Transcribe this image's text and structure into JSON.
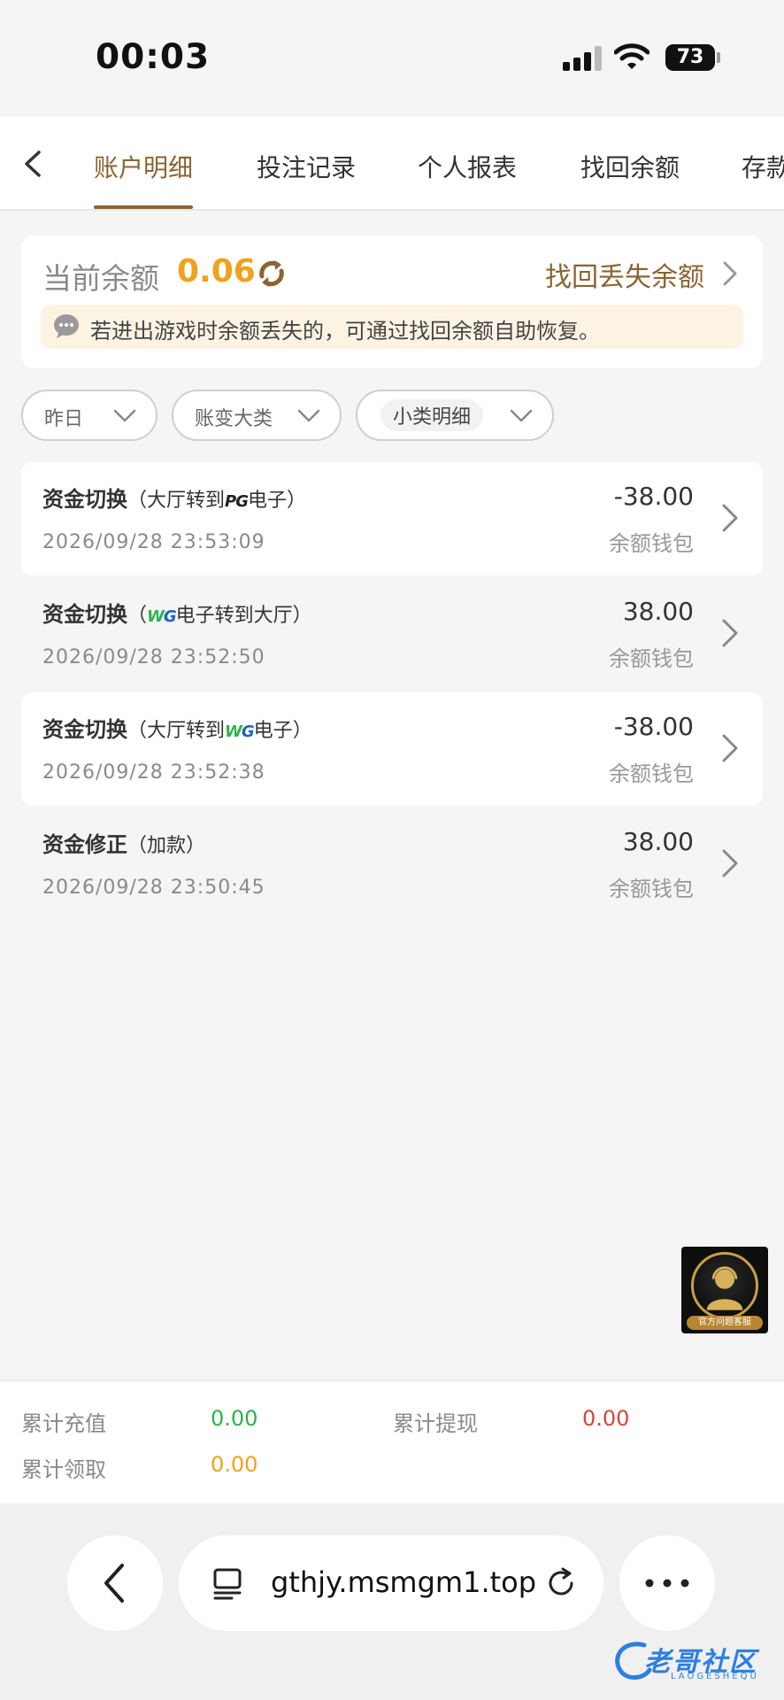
{
  "status_bar": {
    "time": "00:03",
    "battery": "73"
  },
  "tabs": [
    {
      "label": "账户明细",
      "active": true
    },
    {
      "label": "投注记录",
      "active": false
    },
    {
      "label": "个人报表",
      "active": false
    },
    {
      "label": "找回余额",
      "active": false
    },
    {
      "label": "存款",
      "active": false
    }
  ],
  "balance": {
    "label": "当前余额",
    "value": "0.06",
    "recover_link": "找回丢失余额",
    "notice": "若进出游戏时余额丢失的，可通过找回余额自助恢复。"
  },
  "filters": [
    {
      "label": "昨日"
    },
    {
      "label": "账变大类"
    },
    {
      "label": "小类明细"
    }
  ],
  "records": [
    {
      "title": "资金切换",
      "paren_open": "（",
      "sub_pre": "大厅转到",
      "logo": "PG",
      "sub_post": "电子",
      "paren_close": "）",
      "date": "2026/09/28 23:53:09",
      "amount": "-38.00",
      "wallet": "余额钱包"
    },
    {
      "title": "资金切换",
      "paren_open": "（",
      "sub_pre": "",
      "logo": "WG",
      "sub_post": "电子转到大厅",
      "paren_close": "）",
      "date": "2026/09/28 23:52:50",
      "amount": "38.00",
      "wallet": "余额钱包"
    },
    {
      "title": "资金切换",
      "paren_open": "（",
      "sub_pre": "大厅转到",
      "logo": "WG",
      "sub_post": "电子",
      "paren_close": "）",
      "date": "2026/09/28 23:52:38",
      "amount": "-38.00",
      "wallet": "余额钱包"
    },
    {
      "title": "资金修正",
      "paren_open": "（",
      "sub_pre": "加款",
      "logo": "",
      "sub_post": "",
      "paren_close": "）",
      "date": "2026/09/28 23:50:45",
      "amount": "38.00",
      "wallet": "余额钱包"
    }
  ],
  "support": {
    "label": "官方问题客服"
  },
  "totals": {
    "recharge_label": "累计充值",
    "recharge_value": "0.00",
    "withdraw_label": "累计提现",
    "withdraw_value": "0.00",
    "claim_label": "累计领取",
    "claim_value": "0.00"
  },
  "browser": {
    "url": "gthjy.msmgm1.top"
  },
  "watermark": {
    "text": "老哥社区",
    "sub": "LAOGESHEQU"
  },
  "colors": {
    "accent": "#8b6432",
    "balance": "#f0a21c",
    "green": "#2cb34a",
    "red": "#d9433a",
    "orange": "#f0a21c"
  }
}
